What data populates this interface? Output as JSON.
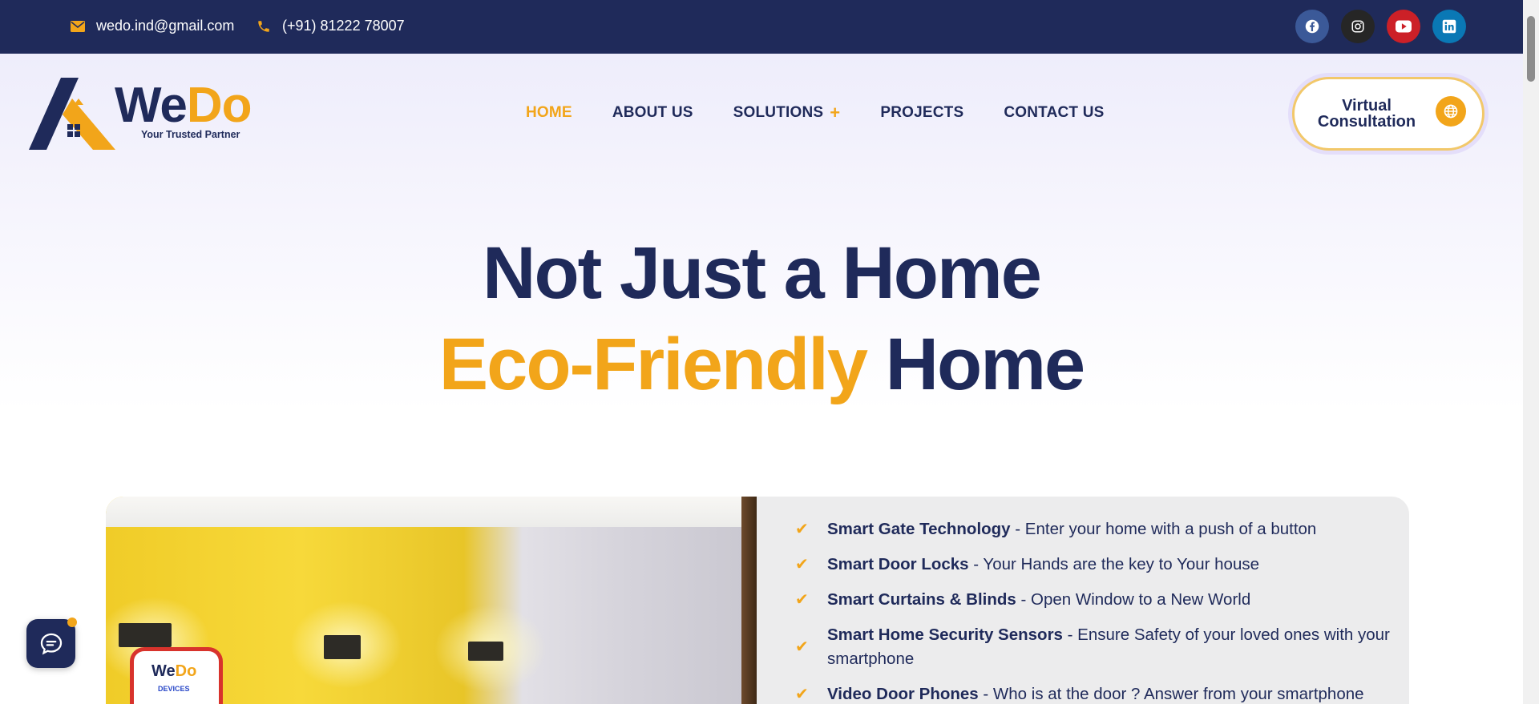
{
  "topbar": {
    "email": "wedo.ind@gmail.com",
    "phone": "(+91) 81222 78007",
    "social_icons": [
      "facebook-icon",
      "instagram-icon",
      "youtube-icon",
      "linkedin-icon"
    ]
  },
  "logo": {
    "part1": "We",
    "part2": "Do",
    "tagline": "Your Trusted Partner"
  },
  "nav": {
    "items": [
      {
        "label": "HOME",
        "active": true
      },
      {
        "label": "ABOUT US"
      },
      {
        "label": "SOLUTIONS"
      },
      {
        "label": "PROJECTS"
      },
      {
        "label": "CONTACT US"
      }
    ]
  },
  "cta": {
    "label_line1": "Virtual",
    "label_line2": "Consultation"
  },
  "hero": {
    "line1": "Not Just a Home",
    "line2_accent": "Eco-Friendly",
    "line2_rest": "Home"
  },
  "phone_mock": {
    "logo1": "We",
    "logo2": "Do",
    "label": "DEVICES"
  },
  "features": [
    {
      "title": "Smart Gate Technology",
      "desc": " - Enter your home with a push of a button"
    },
    {
      "title": "Smart Door Locks",
      "desc": " - Your Hands are the key to Your house"
    },
    {
      "title": "Smart Curtains & Blinds",
      "desc": " - Open Window to a New World"
    },
    {
      "title": "Smart Home Security Sensors",
      "desc": " - Ensure Safety of your loved ones with your smartphone"
    },
    {
      "title": "Video Door Phones",
      "desc": " - Who is at the door ? Answer from your smartphone"
    }
  ],
  "colors": {
    "navy": "#1f2a5a",
    "accent": "#f2a51a",
    "facebook": "#3b5998",
    "instagram": "#262626",
    "youtube": "#cc2027",
    "linkedin": "#0a78b5"
  }
}
